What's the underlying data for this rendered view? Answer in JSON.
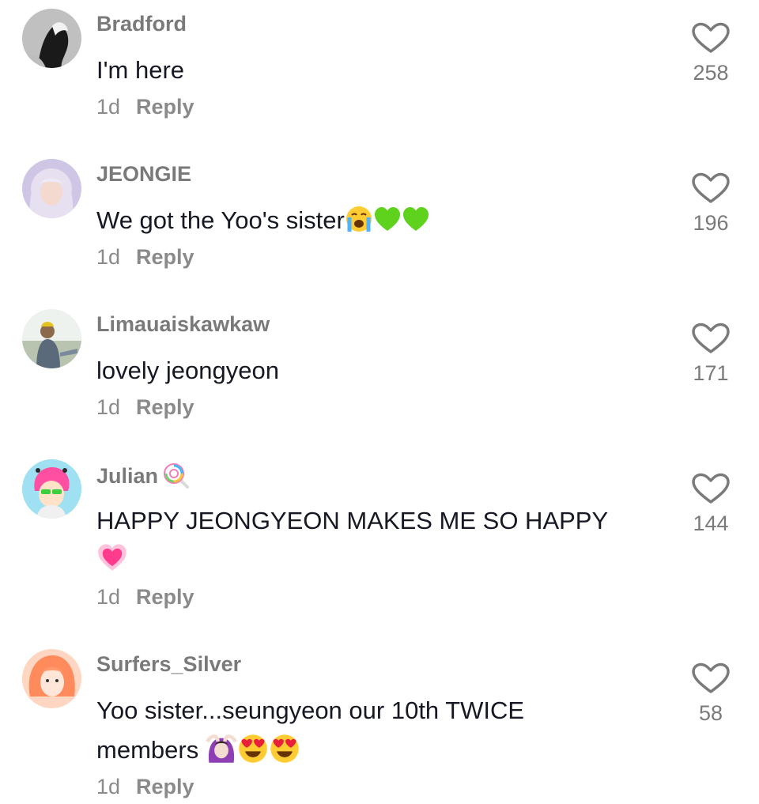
{
  "comments": [
    {
      "username": "Bradford",
      "text": "I'm here",
      "time": "1d",
      "reply_label": "Reply",
      "likes": "258",
      "avatar": "avatar-bw-figure"
    },
    {
      "username": "JEONGIE",
      "text": "We got the Yoo's sister",
      "time": "1d",
      "reply_label": "Reply",
      "likes": "196",
      "avatar": "avatar-blonde-girl",
      "emojis": [
        "loudly-crying-face-icon",
        "green-heart-icon",
        "green-heart-icon"
      ]
    },
    {
      "username": "Limauaiskawkaw",
      "text": "lovely jeongyeon",
      "time": "1d",
      "reply_label": "Reply",
      "likes": "171",
      "avatar": "avatar-person-outdoor"
    },
    {
      "username": "Julian",
      "text": "HAPPY JEONGYEON MAKES ME SO HAPPY",
      "time": "1d",
      "reply_label": "Reply",
      "likes": "144",
      "avatar": "avatar-anime-pink-hair",
      "badge": "lollipop-icon",
      "emojis": [
        "growing-heart-icon"
      ]
    },
    {
      "username": "Surfers_Silver",
      "text_line1": "Yoo sister...seungyeon our 10th TWICE",
      "text_line2": "members",
      "time": "1d",
      "reply_label": "Reply",
      "likes": "58",
      "avatar": "avatar-orange-hair",
      "emojis": [
        "woman-ok-gesture-icon",
        "heart-eyes-face-icon",
        "heart-eyes-face-icon"
      ]
    }
  ],
  "colors": {
    "username": "#7a7a7a",
    "text": "#161823",
    "meta": "#8a8a8a",
    "green_heart": "#5fd21e",
    "pink_heart": "#ff3b8d"
  }
}
